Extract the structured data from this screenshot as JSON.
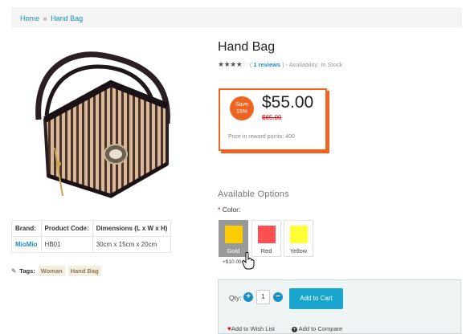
{
  "breadcrumb": {
    "home": "Home",
    "separator": "»",
    "current": "Hand Bag"
  },
  "specs": {
    "headers": [
      "Brand:",
      "Product Code:",
      "Dimensions (L x W x H)"
    ],
    "row": {
      "brand": "MioMio",
      "code": "HB01",
      "dimensions": "30cm x 15cm x 20cm"
    }
  },
  "tags": {
    "label": "Tags:",
    "items": [
      "Woman",
      "Hand Bag"
    ]
  },
  "product": {
    "title": "Hand Bag",
    "rating": 4,
    "rating_max": 5,
    "stars": {
      "filled": "★★★★",
      "empty": "☆"
    },
    "reviews": "1 reviews",
    "availability": "- Availability: In Stock"
  },
  "price": {
    "save_label": "Save",
    "save_percent": "15%",
    "current": "$55.00",
    "old": "$65.00",
    "reward": "Price in reward points: 400",
    "accent_color": "#f06422"
  },
  "options": {
    "title": "Available Options",
    "color_label": "Color:",
    "required_marker": "*",
    "swatches": [
      {
        "label": "Gold",
        "color": "#ffcc00",
        "selected": true
      },
      {
        "label": "Red",
        "color": "#ff5050",
        "selected": false
      },
      {
        "label": "Yellow",
        "color": "#ffff33",
        "selected": false
      }
    ],
    "surcharge": "+$10.00"
  },
  "cart": {
    "qty_label": "Qty:",
    "qty_value": "1",
    "add_to_cart": "Add to Cart",
    "wishlist": "Add to Wish List",
    "compare": "Add to Compare",
    "button_color": "#1aa5cf"
  }
}
